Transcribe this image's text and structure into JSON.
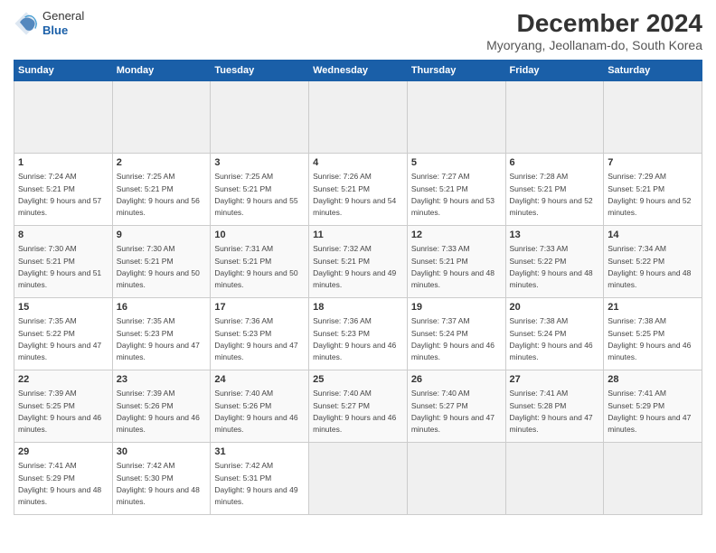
{
  "header": {
    "logo_general": "General",
    "logo_blue": "Blue",
    "main_title": "December 2024",
    "subtitle": "Myoryang, Jeollanam-do, South Korea"
  },
  "calendar": {
    "days_of_week": [
      "Sunday",
      "Monday",
      "Tuesday",
      "Wednesday",
      "Thursday",
      "Friday",
      "Saturday"
    ],
    "weeks": [
      [
        {
          "day": "",
          "empty": true
        },
        {
          "day": "",
          "empty": true
        },
        {
          "day": "",
          "empty": true
        },
        {
          "day": "",
          "empty": true
        },
        {
          "day": "",
          "empty": true
        },
        {
          "day": "",
          "empty": true
        },
        {
          "day": "",
          "empty": true
        }
      ],
      [
        {
          "num": "1",
          "sunrise": "7:24 AM",
          "sunset": "5:21 PM",
          "daylight": "9 hours and 57 minutes."
        },
        {
          "num": "2",
          "sunrise": "7:25 AM",
          "sunset": "5:21 PM",
          "daylight": "9 hours and 56 minutes."
        },
        {
          "num": "3",
          "sunrise": "7:25 AM",
          "sunset": "5:21 PM",
          "daylight": "9 hours and 55 minutes."
        },
        {
          "num": "4",
          "sunrise": "7:26 AM",
          "sunset": "5:21 PM",
          "daylight": "9 hours and 54 minutes."
        },
        {
          "num": "5",
          "sunrise": "7:27 AM",
          "sunset": "5:21 PM",
          "daylight": "9 hours and 53 minutes."
        },
        {
          "num": "6",
          "sunrise": "7:28 AM",
          "sunset": "5:21 PM",
          "daylight": "9 hours and 52 minutes."
        },
        {
          "num": "7",
          "sunrise": "7:29 AM",
          "sunset": "5:21 PM",
          "daylight": "9 hours and 52 minutes."
        }
      ],
      [
        {
          "num": "8",
          "sunrise": "7:30 AM",
          "sunset": "5:21 PM",
          "daylight": "9 hours and 51 minutes."
        },
        {
          "num": "9",
          "sunrise": "7:30 AM",
          "sunset": "5:21 PM",
          "daylight": "9 hours and 50 minutes."
        },
        {
          "num": "10",
          "sunrise": "7:31 AM",
          "sunset": "5:21 PM",
          "daylight": "9 hours and 50 minutes."
        },
        {
          "num": "11",
          "sunrise": "7:32 AM",
          "sunset": "5:21 PM",
          "daylight": "9 hours and 49 minutes."
        },
        {
          "num": "12",
          "sunrise": "7:33 AM",
          "sunset": "5:21 PM",
          "daylight": "9 hours and 48 minutes."
        },
        {
          "num": "13",
          "sunrise": "7:33 AM",
          "sunset": "5:22 PM",
          "daylight": "9 hours and 48 minutes."
        },
        {
          "num": "14",
          "sunrise": "7:34 AM",
          "sunset": "5:22 PM",
          "daylight": "9 hours and 48 minutes."
        }
      ],
      [
        {
          "num": "15",
          "sunrise": "7:35 AM",
          "sunset": "5:22 PM",
          "daylight": "9 hours and 47 minutes."
        },
        {
          "num": "16",
          "sunrise": "7:35 AM",
          "sunset": "5:23 PM",
          "daylight": "9 hours and 47 minutes."
        },
        {
          "num": "17",
          "sunrise": "7:36 AM",
          "sunset": "5:23 PM",
          "daylight": "9 hours and 47 minutes."
        },
        {
          "num": "18",
          "sunrise": "7:36 AM",
          "sunset": "5:23 PM",
          "daylight": "9 hours and 46 minutes."
        },
        {
          "num": "19",
          "sunrise": "7:37 AM",
          "sunset": "5:24 PM",
          "daylight": "9 hours and 46 minutes."
        },
        {
          "num": "20",
          "sunrise": "7:38 AM",
          "sunset": "5:24 PM",
          "daylight": "9 hours and 46 minutes."
        },
        {
          "num": "21",
          "sunrise": "7:38 AM",
          "sunset": "5:25 PM",
          "daylight": "9 hours and 46 minutes."
        }
      ],
      [
        {
          "num": "22",
          "sunrise": "7:39 AM",
          "sunset": "5:25 PM",
          "daylight": "9 hours and 46 minutes."
        },
        {
          "num": "23",
          "sunrise": "7:39 AM",
          "sunset": "5:26 PM",
          "daylight": "9 hours and 46 minutes."
        },
        {
          "num": "24",
          "sunrise": "7:40 AM",
          "sunset": "5:26 PM",
          "daylight": "9 hours and 46 minutes."
        },
        {
          "num": "25",
          "sunrise": "7:40 AM",
          "sunset": "5:27 PM",
          "daylight": "9 hours and 46 minutes."
        },
        {
          "num": "26",
          "sunrise": "7:40 AM",
          "sunset": "5:27 PM",
          "daylight": "9 hours and 47 minutes."
        },
        {
          "num": "27",
          "sunrise": "7:41 AM",
          "sunset": "5:28 PM",
          "daylight": "9 hours and 47 minutes."
        },
        {
          "num": "28",
          "sunrise": "7:41 AM",
          "sunset": "5:29 PM",
          "daylight": "9 hours and 47 minutes."
        }
      ],
      [
        {
          "num": "29",
          "sunrise": "7:41 AM",
          "sunset": "5:29 PM",
          "daylight": "9 hours and 48 minutes."
        },
        {
          "num": "30",
          "sunrise": "7:42 AM",
          "sunset": "5:30 PM",
          "daylight": "9 hours and 48 minutes."
        },
        {
          "num": "31",
          "sunrise": "7:42 AM",
          "sunset": "5:31 PM",
          "daylight": "9 hours and 49 minutes."
        },
        {
          "day": "",
          "empty": true
        },
        {
          "day": "",
          "empty": true
        },
        {
          "day": "",
          "empty": true
        },
        {
          "day": "",
          "empty": true
        }
      ]
    ]
  }
}
